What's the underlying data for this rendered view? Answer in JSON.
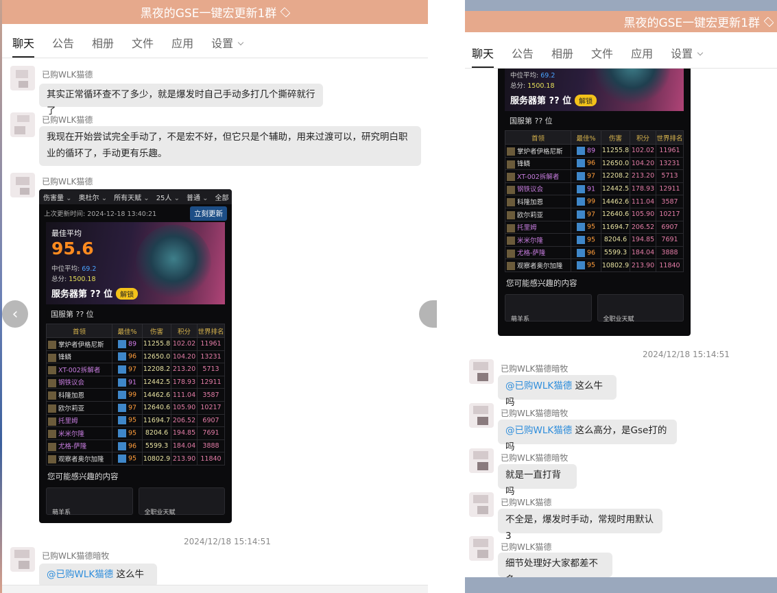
{
  "group_title": "黑夜的GSE一键宏更新1群",
  "tabs": [
    "聊天",
    "公告",
    "相册",
    "文件",
    "应用",
    "设置"
  ],
  "shot": {
    "filters": [
      "伤害量",
      "奥杜尔",
      "所有天赋",
      "25人",
      "普通",
      "全部"
    ],
    "update_time": "上次更新时间: 2024-12-18 13:40:21",
    "update_button": "立刻更新",
    "best_avg_label": "最佳平均",
    "best_avg": "95.6",
    "median_label": "中位平均:",
    "median": "69.2",
    "total_label": "总分:",
    "total": "1500.18",
    "server_rank": "服务器第 ?? 位",
    "unlock": "解锁",
    "national_rank": "国服第 ?? 位",
    "columns": [
      "首领",
      "最佳%",
      "伤害",
      "积分",
      "世界排名"
    ],
    "rows": [
      {
        "boss": "掌炉者伊格尼斯",
        "best": "89",
        "dmg": "11255.8",
        "pts": "102.02",
        "rank": "11961",
        "bc": "#d27be8"
      },
      {
        "boss": "锋鳞",
        "best": "96",
        "dmg": "12650.0",
        "pts": "104.20",
        "rank": "13231",
        "bc": "#ff9d3b"
      },
      {
        "boss": "XT-002拆解者",
        "best": "97",
        "dmg": "12208.2",
        "pts": "213.20",
        "rank": "5713",
        "bc": "#ff9d3b"
      },
      {
        "boss": "钢铁议会",
        "best": "91",
        "dmg": "12442.5",
        "pts": "178.93",
        "rank": "12911",
        "bc": "#d27be8"
      },
      {
        "boss": "科隆加恩",
        "best": "99",
        "dmg": "14462.6",
        "pts": "111.04",
        "rank": "3587",
        "bc": "#ff9d3b"
      },
      {
        "boss": "欧尔莉亚",
        "best": "97",
        "dmg": "12640.6",
        "pts": "105.90",
        "rank": "10217",
        "bc": "#ff9d3b"
      },
      {
        "boss": "托里姆",
        "best": "95",
        "dmg": "11694.7",
        "pts": "206.52",
        "rank": "6907",
        "bc": "#ff9d3b"
      },
      {
        "boss": "米米尔隆",
        "best": "95",
        "dmg": "8204.6",
        "pts": "194.85",
        "rank": "7691",
        "bc": "#ff9d3b"
      },
      {
        "boss": "尤格-萨隆",
        "best": "96",
        "dmg": "5599.3",
        "pts": "184.04",
        "rank": "3888",
        "bc": "#ff9d3b"
      },
      {
        "boss": "观察者奥尔加隆",
        "best": "95",
        "dmg": "10802.9",
        "pts": "213.90",
        "rank": "11840",
        "bc": "#ff9d3b"
      }
    ],
    "interest": "您可能感兴趣的内容",
    "card1": "萌羊系",
    "card2": "全职业天赋"
  },
  "left_msgs": [
    {
      "sender": "已购WLK猫德",
      "text": "其实正常循环查不了多少，就是爆发时自己手动多打几个撕碎就行了"
    },
    {
      "sender": "已购WLK猫德",
      "text": "我现在开始尝试完全手动了，不是宏不好，但它只是个辅助，用来过渡可以，研究明白职业的循环了，手动更有乐趣。"
    },
    {
      "sender": "已购WLK猫德"
    },
    {
      "sender": "已购WLK猫德暗牧",
      "mention": "@已购WLK猫德",
      "text": " 这么牛吗"
    }
  ],
  "timestamp": "2024/12/18 15:14:51",
  "right_msgs": [
    {
      "sender": "已购WLK猫德暗牧",
      "mention": "@已购WLK猫德",
      "text": " 这么牛吗"
    },
    {
      "sender": "已购WLK猫德暗牧",
      "mention": "@已购WLK猫德",
      "text": " 这么高分，是Gse打的吗"
    },
    {
      "sender": "已购WLK猫德暗牧",
      "text": "就是一直打背吗"
    },
    {
      "sender": "已购WLK猫德",
      "text": "不全是，爆发时手动，常规时用默认3"
    },
    {
      "sender": "已购WLK猫德",
      "text": "细节处理好大家都差不多"
    }
  ]
}
